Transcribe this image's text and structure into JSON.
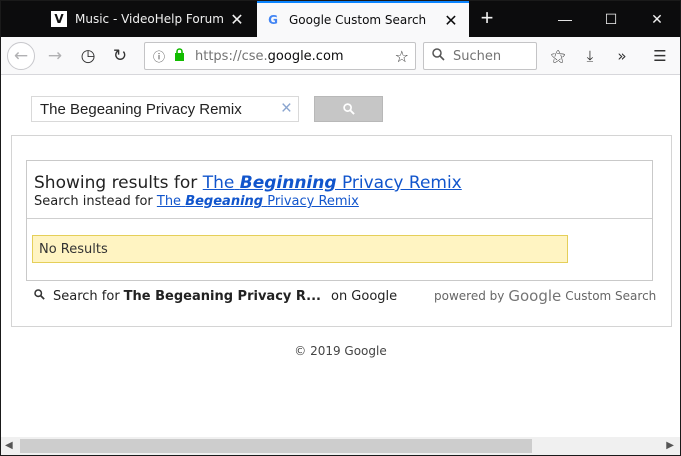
{
  "browser": {
    "tabs": [
      {
        "title": "Music - VideoHelp Forum",
        "favicon": "videohelp-favicon",
        "active": false
      },
      {
        "title": "Google Custom Search",
        "favicon": "google-favicon",
        "active": true
      }
    ],
    "new_tab_label": "+",
    "url_scheme": "https://cse.",
    "url_host": "google.com",
    "search_placeholder": "Suchen",
    "accent_color": "#0a84ff",
    "icons": {
      "close": "✕",
      "minimize": "—",
      "maximize": "☐",
      "window_close": "✕",
      "back": "←",
      "forward": "→",
      "history": "◷",
      "reload": "↻",
      "bookmark_star": "☆",
      "library": "⚝",
      "download": "⤓",
      "overflow": "»",
      "menu": "☰",
      "info": "ⓘ",
      "lock": "🔒",
      "magnifier": "🔍"
    }
  },
  "cse": {
    "query": "The Begeaning Privacy Remix",
    "clear_icon": "×",
    "showing_prefix": "Showing results for ",
    "corrected_the": "The",
    "corrected_word": "Beginning",
    "corrected_rest": "Privacy Remix",
    "instead_prefix": "Search instead for ",
    "original_the": "The",
    "original_word": "Begeaning",
    "original_rest": "Privacy Remix",
    "no_results": "No Results",
    "search_for_prefix": "Search for",
    "search_for_query": "The Begeaning Privacy R...",
    "search_for_suffix": "on Google",
    "powered_by": "powered by",
    "google_word": "Google",
    "custom_search": "Custom Search",
    "copyright": "© 2019 Google",
    "link_color": "#1155cc",
    "no_results_bg": "#fff4c2"
  }
}
